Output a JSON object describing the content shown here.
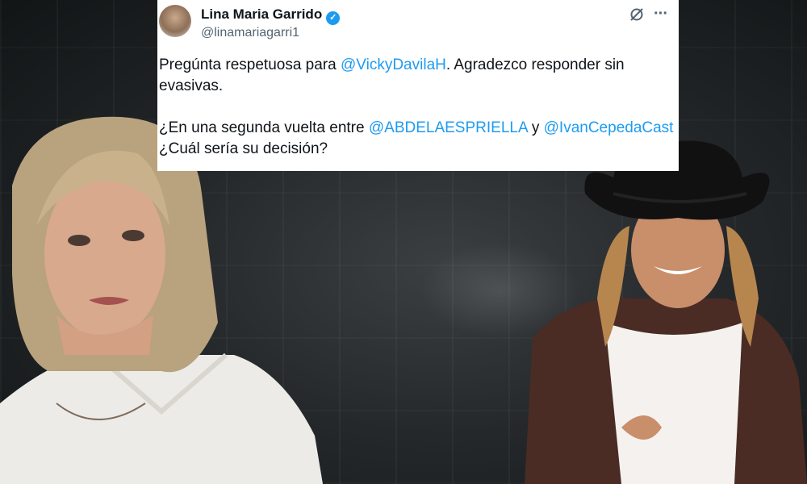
{
  "tweet": {
    "author_name": "Lina Maria Garrido",
    "handle": "@linamariagarri1",
    "line1_prefix": "Pregúnta respetuosa para ",
    "mention1": "@VickyDavilaH",
    "line1_suffix": ". Agradezco responder sin evasivas.",
    "line2_prefix": "¿En una segunda vuelta entre ",
    "mention2": "@ABDELAESPRIELLA",
    "line2_mid": " y ",
    "mention3": "@IvanCepedaCast",
    "line2_suffix": " ¿Cuál sería su decisión?",
    "icons": [
      "avatar",
      "verified-badge-icon",
      "grok-icon",
      "more-icon"
    ],
    "mention_color": "#1d9bf0"
  }
}
